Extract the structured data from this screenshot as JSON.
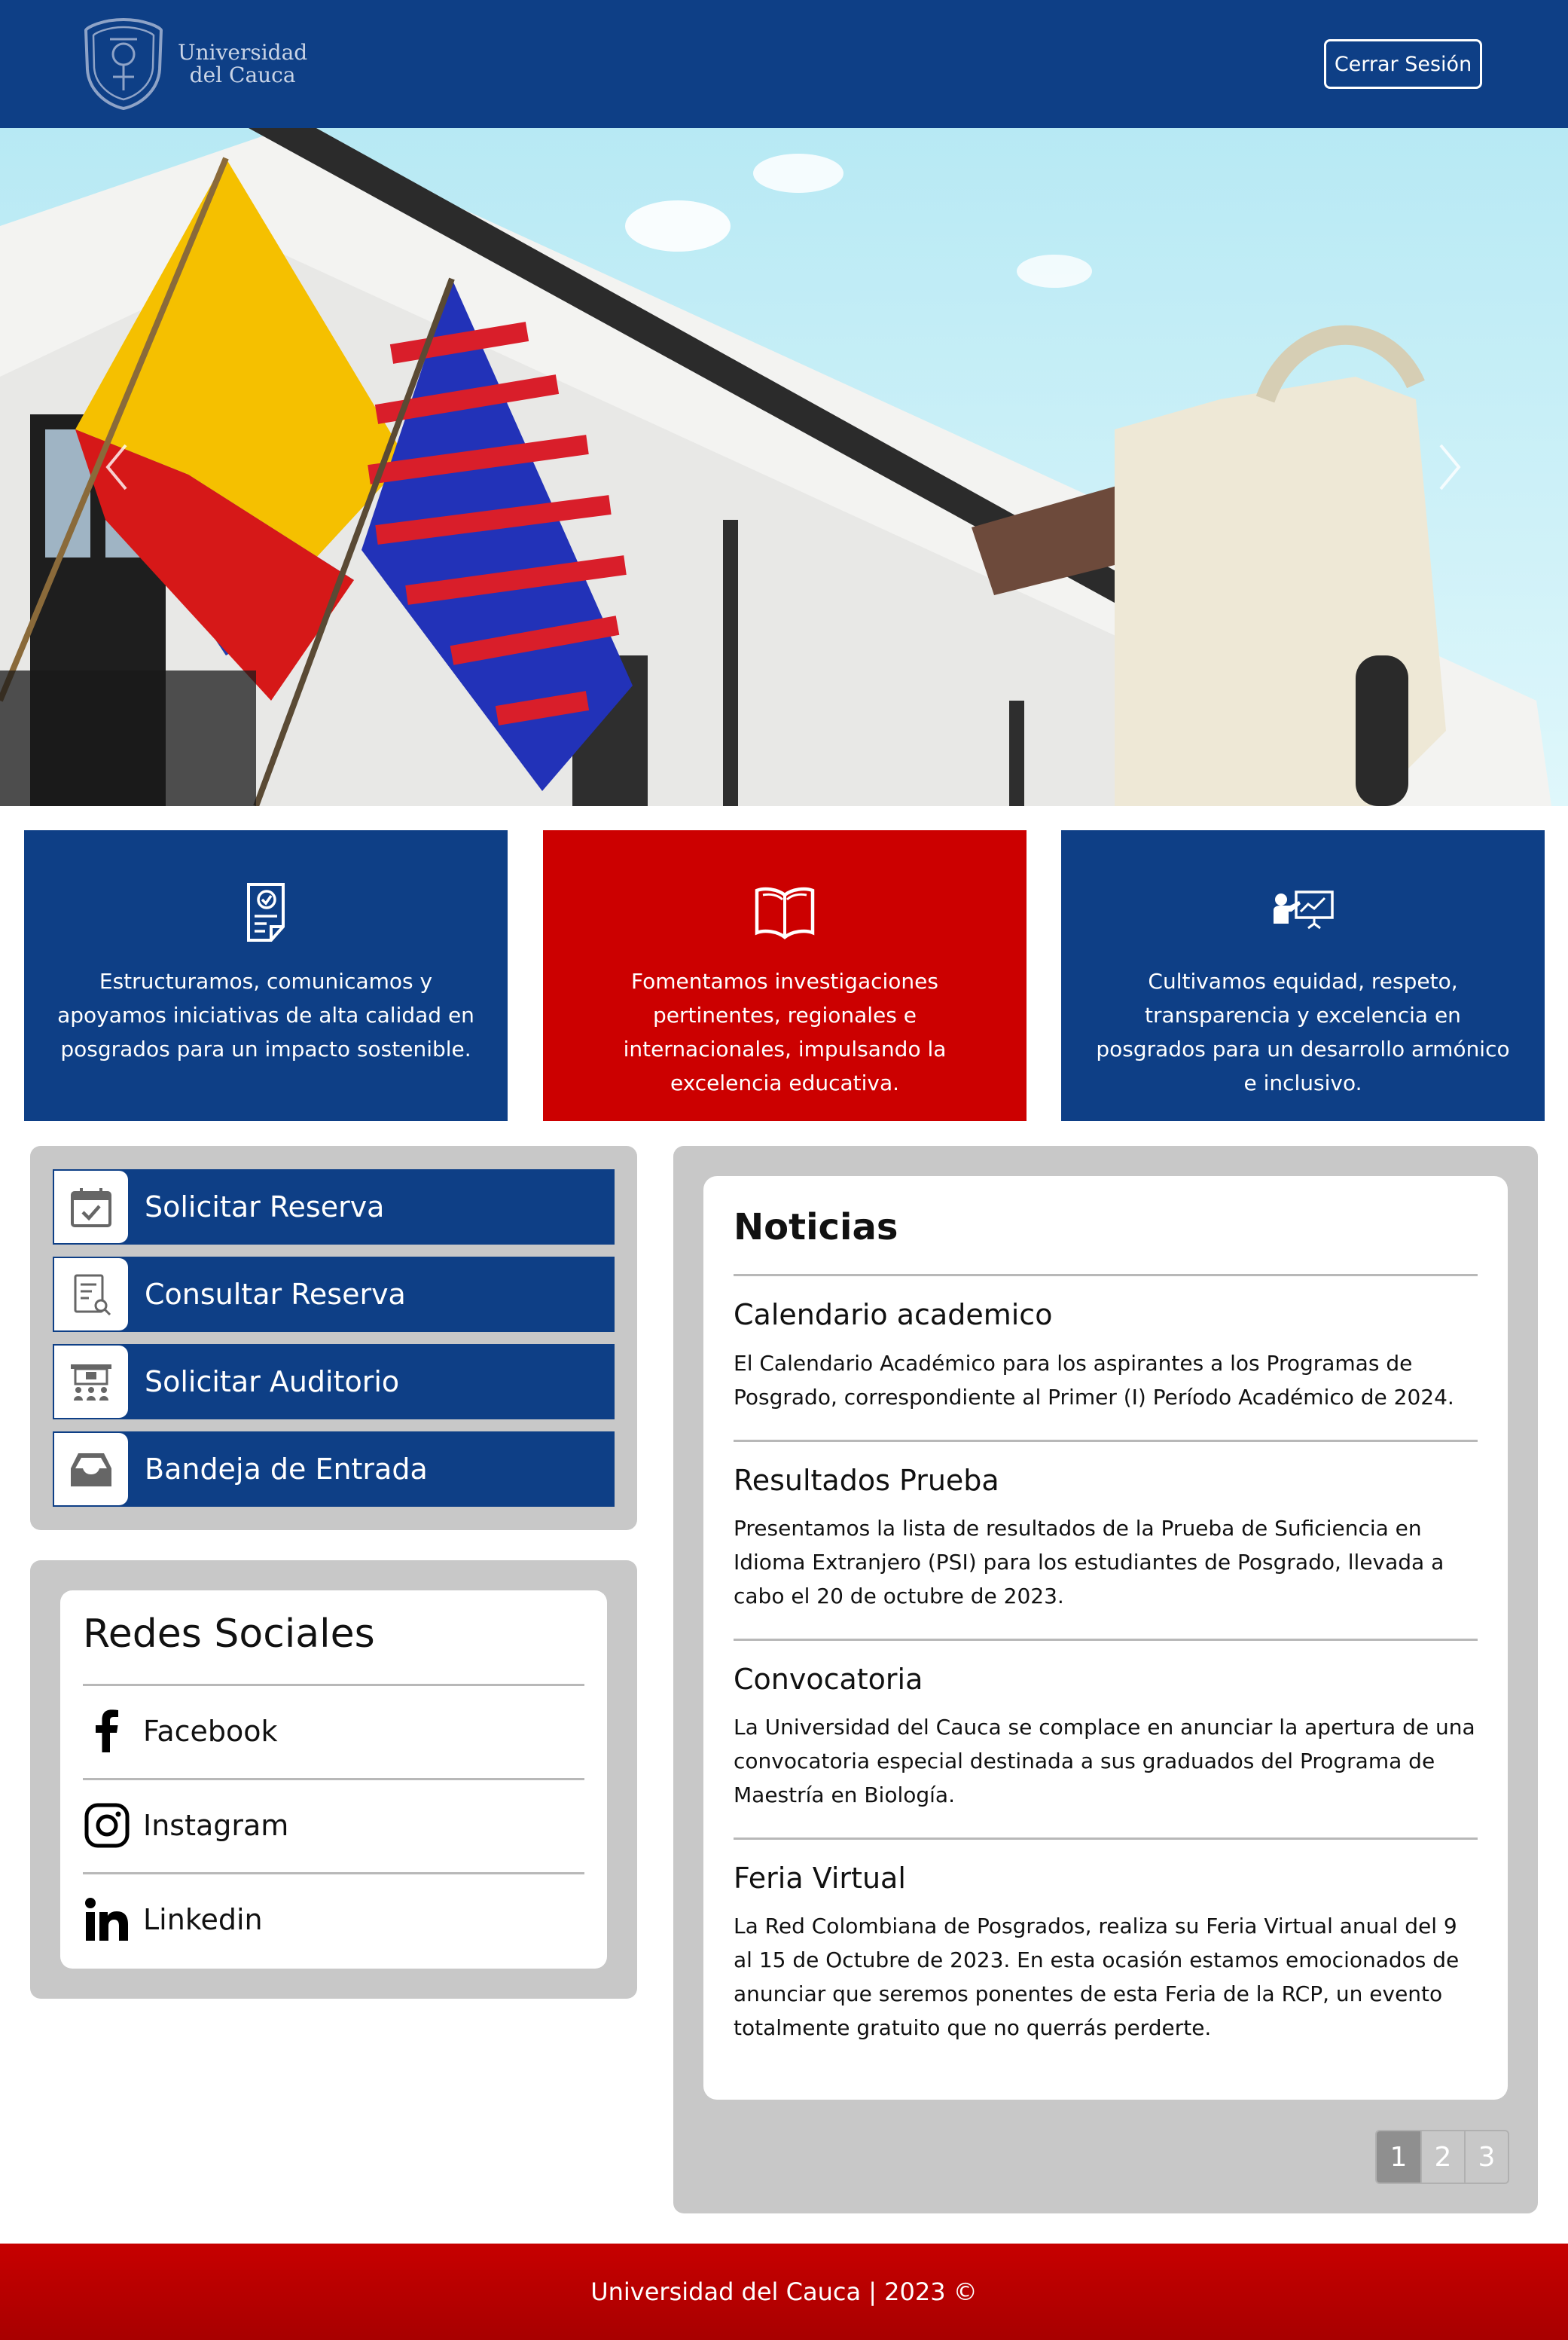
{
  "header": {
    "logo_line1": "Universidad",
    "logo_line2": "del Cauca",
    "logout_label": "Cerrar Sesión"
  },
  "features": [
    {
      "icon": "document-check-icon",
      "text": "Estructuramos, comunicamos y apoyamos iniciativas de alta calidad en posgrados para un impacto sostenible.",
      "color": "#0e3f86"
    },
    {
      "icon": "open-book-icon",
      "text": "Fomentamos investigaciones pertinentes, regionales e internacionales, impulsando la excelencia educativa.",
      "color": "#cc0000"
    },
    {
      "icon": "teacher-presentation-icon",
      "text": "Cultivamos equidad, respeto, transparencia y excelencia en posgrados para un desarrollo armónico e inclusivo.",
      "color": "#0e3f86"
    }
  ],
  "menu": [
    {
      "icon": "calendar-check-icon",
      "label": "Solicitar Reserva"
    },
    {
      "icon": "document-search-icon",
      "label": "Consultar Reserva"
    },
    {
      "icon": "auditorium-icon",
      "label": "Solicitar Auditorio"
    },
    {
      "icon": "inbox-tray-icon",
      "label": "Bandeja de Entrada"
    }
  ],
  "social": {
    "title": "Redes Sociales",
    "items": [
      {
        "icon": "facebook-icon",
        "label": "Facebook"
      },
      {
        "icon": "instagram-icon",
        "label": "Instagram"
      },
      {
        "icon": "linkedin-icon",
        "label": "Linkedin"
      }
    ]
  },
  "news": {
    "heading": "Noticias",
    "items": [
      {
        "title": "Calendario academico",
        "body": "El Calendario Académico para los aspirantes a los Programas de Posgrado, correspondiente al Primer (I) Período Académico de 2024."
      },
      {
        "title": "Resultados Prueba",
        "body": "Presentamos la lista de resultados de la Prueba de Suficiencia en Idioma Extranjero (PSI) para los estudiantes de Posgrado, llevada a cabo el 20 de octubre de 2023."
      },
      {
        "title": "Convocatoria",
        "body": "La Universidad del Cauca se complace en anunciar la apertura de una convocatoria especial destinada a sus graduados del Programa de Maestría en Biología."
      },
      {
        "title": "Feria Virtual",
        "body": "La Red Colombiana de Posgrados, realiza su Feria Virtual anual del 9 al 15 de Octubre de 2023. En esta ocasión estamos emocionados de anunciar que seremos ponentes de esta Feria de la RCP, un evento totalmente gratuito que no querrás perderte."
      }
    ],
    "pages": [
      "1",
      "2",
      "3"
    ],
    "current_page": "1"
  },
  "footer": {
    "text": "Universidad del Cauca | 2023 ©"
  },
  "colors": {
    "primary_blue": "#0e3f86",
    "accent_red": "#cc0000",
    "panel_gray": "#c8c8c8"
  }
}
